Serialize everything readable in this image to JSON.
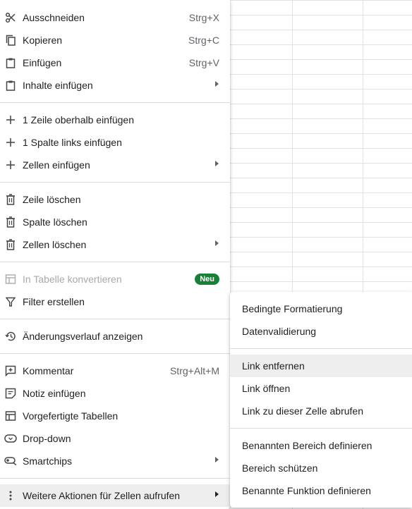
{
  "context_menu": {
    "cut": {
      "label": "Ausschneiden",
      "shortcut": "Strg+X",
      "icon": "scissors-icon"
    },
    "copy": {
      "label": "Kopieren",
      "shortcut": "Strg+C",
      "icon": "copy-icon"
    },
    "paste": {
      "label": "Einfügen",
      "shortcut": "Strg+V",
      "icon": "clipboard-icon"
    },
    "paste_special": {
      "label": "Inhalte einfügen",
      "icon": "clipboard-icon"
    },
    "insert_row": {
      "label": "1 Zeile oberhalb einfügen",
      "icon": "plus-icon"
    },
    "insert_column": {
      "label": "1 Spalte links einfügen",
      "icon": "plus-icon"
    },
    "insert_cells": {
      "label": "Zellen einfügen",
      "icon": "plus-icon"
    },
    "delete_row": {
      "label": "Zeile löschen",
      "icon": "trash-icon"
    },
    "delete_column": {
      "label": "Spalte löschen",
      "icon": "trash-icon"
    },
    "delete_cells": {
      "label": "Zellen löschen",
      "icon": "trash-icon"
    },
    "convert_table": {
      "label": "In Tabelle konvertieren",
      "badge": "Neu",
      "icon": "table-icon"
    },
    "create_filter": {
      "label": "Filter erstellen",
      "icon": "filter-icon"
    },
    "edit_history": {
      "label": "Änderungsverlauf anzeigen",
      "icon": "history-icon"
    },
    "comment": {
      "label": "Kommentar",
      "shortcut": "Strg+Alt+M",
      "icon": "comment-add-icon"
    },
    "note": {
      "label": "Notiz einfügen",
      "icon": "note-icon"
    },
    "prebuilt_tables": {
      "label": "Vorgefertigte Tabellen",
      "icon": "table-icon"
    },
    "dropdown": {
      "label": "Drop-down",
      "icon": "dropdown-chip-icon"
    },
    "smartchips": {
      "label": "Smartchips",
      "icon": "smartchip-icon"
    },
    "more_actions": {
      "label": "Weitere Aktionen für Zellen aufrufen",
      "icon": "more-vert-icon"
    }
  },
  "submenu": {
    "conditional_formatting": "Bedingte Formatierung",
    "data_validation": "Datenvalidierung",
    "remove_link": "Link entfernen",
    "open_link": "Link öffnen",
    "get_cell_link": "Link zu dieser Zelle abrufen",
    "define_named_range": "Benannten Bereich definieren",
    "protect_range": "Bereich schützen",
    "define_named_function": "Benannte Funktion definieren"
  },
  "colors": {
    "badge": "#188038",
    "separator": "#dadce0",
    "hover": "#eeeeee"
  }
}
